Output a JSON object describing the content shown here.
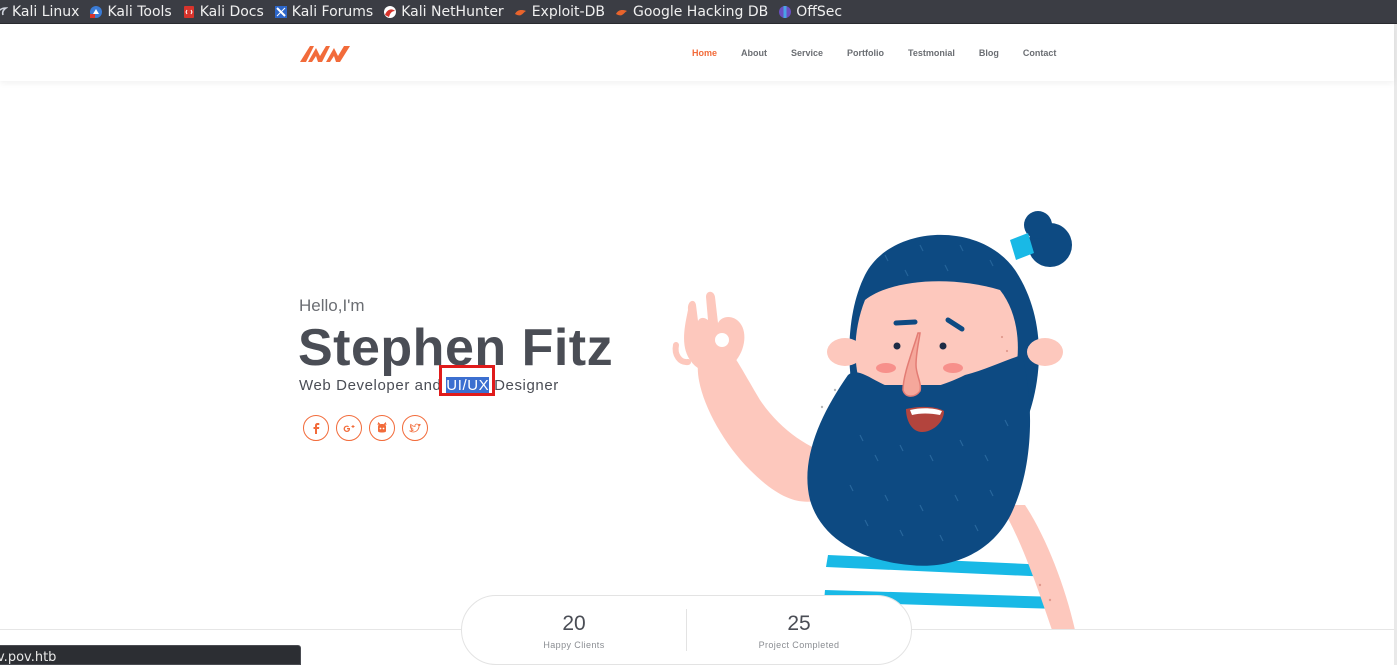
{
  "bookmarks": [
    {
      "label": "Kali Linux",
      "icon": "kali-dragon-icon"
    },
    {
      "label": "Kali Tools",
      "icon": "kali-tools-icon"
    },
    {
      "label": "Kali Docs",
      "icon": "kali-docs-icon"
    },
    {
      "label": "Kali Forums",
      "icon": "kali-forums-icon"
    },
    {
      "label": "Kali NetHunter",
      "icon": "nethunter-icon"
    },
    {
      "label": "Exploit-DB",
      "icon": "exploit-db-icon"
    },
    {
      "label": "Google Hacking DB",
      "icon": "ghdb-icon"
    },
    {
      "label": "OffSec",
      "icon": "offsec-icon"
    }
  ],
  "nav": {
    "items": [
      "Home",
      "About",
      "Service",
      "Portfolio",
      "Testmonial",
      "Blog",
      "Contact"
    ],
    "active": "Home"
  },
  "hero": {
    "greeting": "Hello,I'm",
    "name": "Stephen Fitz",
    "role_before": "Web Developer and ",
    "role_highlight": "UI/UX",
    "role_after": " Designer"
  },
  "socials": [
    {
      "icon": "facebook-icon",
      "glyph": "f"
    },
    {
      "icon": "google-plus-icon",
      "glyph": "g⁺"
    },
    {
      "icon": "github-icon",
      "glyph": "●"
    },
    {
      "icon": "twitter-icon",
      "glyph": "✦"
    }
  ],
  "stats": [
    {
      "value": "20",
      "label": "Happy Clients"
    },
    {
      "value": "25",
      "label": "Project Completed"
    }
  ],
  "status_url": "v.pov.htb",
  "colors": {
    "accent": "#f26b3a",
    "text_dark": "#4a4d55",
    "beard": "#0d4a82",
    "skin": "#fdc8bd",
    "stripe": "#19b9e6",
    "selection": "#3c6fd0",
    "selection_box": "#e01b1b",
    "bookmarks_bg": "#3b3d44"
  }
}
